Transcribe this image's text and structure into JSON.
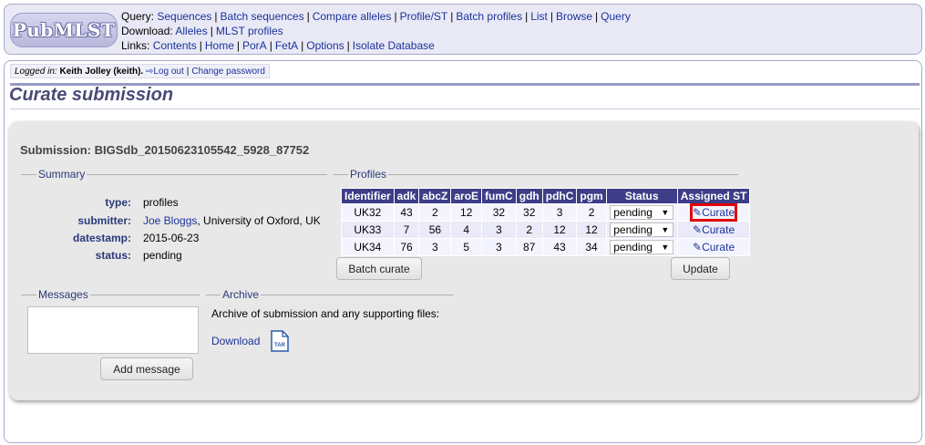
{
  "header": {
    "logo_text": "PubMLST",
    "query_label": "Query:",
    "query_links": [
      "Sequences",
      "Batch sequences",
      "Compare alleles",
      "Profile/ST",
      "Batch profiles",
      "List",
      "Browse",
      "Query"
    ],
    "download_label": "Download:",
    "download_links": [
      "Alleles",
      "MLST profiles"
    ],
    "links_label": "Links:",
    "links_links": [
      "Contents",
      "Home",
      "PorA",
      "FetA",
      "Options",
      "Isolate Database"
    ]
  },
  "login": {
    "prefix": "Logged in:",
    "user": "Keith Jolley (keith).",
    "logout": "Log out",
    "change_password": "Change password"
  },
  "page_title": "Curate submission",
  "submission_heading": "Submission: BIGSdb_20150623105542_5928_87752",
  "summary": {
    "legend": "Summary",
    "type_key": "type:",
    "type_val": "profiles",
    "submitter_key": "submitter:",
    "submitter_name": "Joe Bloggs",
    "submitter_affil": ", University of Oxford, UK",
    "datestamp_key": "datestamp:",
    "datestamp_val": "2015-06-23",
    "status_key": "status:",
    "status_val": "pending"
  },
  "profiles": {
    "legend": "Profiles",
    "headers": [
      "Identifier",
      "adk",
      "abcZ",
      "aroE",
      "fumC",
      "gdh",
      "pdhC",
      "pgm",
      "Status",
      "Assigned ST"
    ],
    "rows": [
      {
        "id": "UK32",
        "vals": [
          "43",
          "2",
          "12",
          "32",
          "32",
          "3",
          "2"
        ],
        "status": "pending",
        "action": "Curate"
      },
      {
        "id": "UK33",
        "vals": [
          "7",
          "56",
          "4",
          "3",
          "2",
          "12",
          "12"
        ],
        "status": "pending",
        "action": "Curate"
      },
      {
        "id": "UK34",
        "vals": [
          "76",
          "3",
          "5",
          "3",
          "87",
          "43",
          "34"
        ],
        "status": "pending",
        "action": "Curate"
      }
    ],
    "batch_button": "Batch curate",
    "update_button": "Update"
  },
  "messages": {
    "legend": "Messages",
    "textarea_value": "",
    "add_button": "Add message"
  },
  "archive": {
    "legend": "Archive",
    "description": "Archive of submission and any supporting files:",
    "download_link": "Download",
    "icon_text": "TAR"
  }
}
